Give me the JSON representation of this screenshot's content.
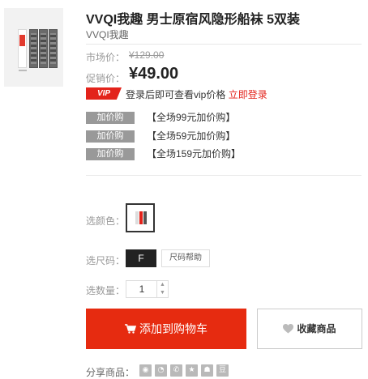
{
  "product": {
    "title": "VVQI我趣 男士原宿风隐形船袜 5双装",
    "brand": "VVQI我趣"
  },
  "prices": {
    "market_label": "市场价：",
    "market_value": "¥129.00",
    "sale_label": "促销价：",
    "sale_value": "¥49.00"
  },
  "vip": {
    "badge": "VIP",
    "text": "登录后即可查看vip价格",
    "login_link": "立即登录"
  },
  "promotions": [
    {
      "badge": "加价购",
      "text": "【全场99元加价购】"
    },
    {
      "badge": "加价购",
      "text": "【全场59元加价购】"
    },
    {
      "badge": "加价购",
      "text": "【全场159元加价购】"
    }
  ],
  "options": {
    "color_label": "选颜色：",
    "size_label": "选尺码：",
    "size_value": "F",
    "size_help": "尺码帮助",
    "qty_label": "选数量：",
    "qty_value": "1"
  },
  "actions": {
    "add_to_cart": "添加到购物车",
    "favorite": "收藏商品"
  },
  "share": {
    "label": "分享商品：",
    "icons": [
      "weibo-icon",
      "wechat-icon",
      "qzone-icon",
      "star-icon",
      "qq-icon",
      "douban-icon"
    ]
  },
  "colors": {
    "accent_red": "#e62b10",
    "vip_red": "#e3231b",
    "promo_grey": "#999999"
  }
}
